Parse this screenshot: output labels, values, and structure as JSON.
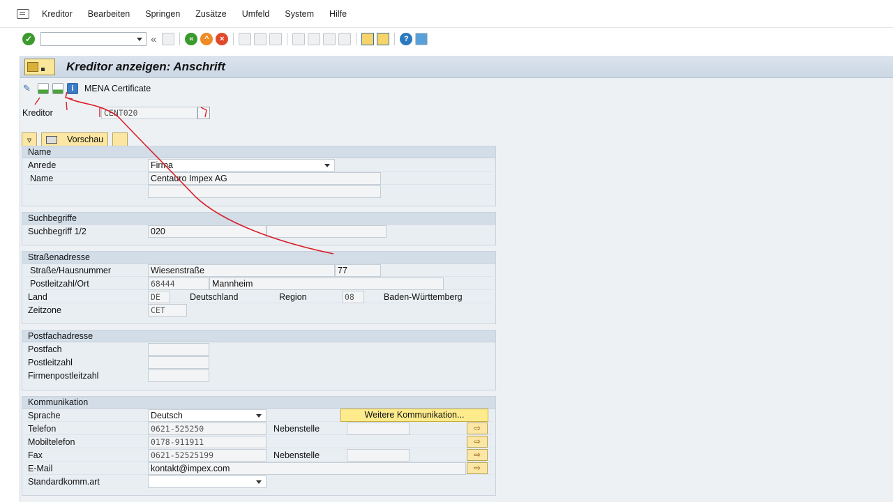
{
  "menu": {
    "items": [
      "Kreditor",
      "Bearbeiten",
      "Springen",
      "Zusätze",
      "Umfeld",
      "System",
      "Hilfe"
    ]
  },
  "toolbar": {
    "command_field": "",
    "back_glyph": "«"
  },
  "title": "Kreditor anzeigen: Anschrift",
  "app_toolbar": {
    "info_glyph": "i",
    "label": "MENA Certificate"
  },
  "kreditor": {
    "label": "Kreditor",
    "value": "CENT020"
  },
  "subbar": {
    "preview_label": "Vorschau"
  },
  "name_group": {
    "title": "Name",
    "anrede_label": "Anrede",
    "anrede_value": "Firma",
    "name_label": "Name",
    "name_value": "Centauro Impex AG",
    "name2_value": ""
  },
  "search_group": {
    "title": "Suchbegriffe",
    "label": "Suchbegriff 1/2",
    "value1": "020",
    "value2": ""
  },
  "street_group": {
    "title": "Straßenadresse",
    "street_label": "Straße/Hausnummer",
    "street_value": "Wiesenstraße",
    "house_no": "77",
    "plz_label": "Postleitzahl/Ort",
    "plz_value": "68444",
    "city_value": "Mannheim",
    "country_label": "Land",
    "country_code": "DE",
    "country_name": "Deutschland",
    "region_label": "Region",
    "region_code": "08",
    "region_name": "Baden-Württemberg",
    "timezone_label": "Zeitzone",
    "timezone_value": "CET"
  },
  "pobox_group": {
    "title": "Postfachadresse",
    "postfach_label": "Postfach",
    "postleitzahl_label": "Postleitzahl",
    "firmen_label": "Firmenpostleitzahl"
  },
  "comm_group": {
    "title": "Kommunikation",
    "sprache_label": "Sprache",
    "sprache_value": "Deutsch",
    "more_button": "Weitere Kommunikation...",
    "telefon_label": "Telefon",
    "telefon_value": "0621-525250",
    "nebenstelle_label": "Nebenstelle",
    "mobil_label": "Mobiltelefon",
    "mobil_value": "0178-911911",
    "fax_label": "Fax",
    "fax_value": "0621-52525199",
    "fax_nebenstelle_label": "Nebenstelle",
    "email_label": "E-Mail",
    "email_value": "kontakt@impex.com",
    "standard_label": "Standardkomm.art",
    "standard_value": ""
  },
  "colors": {
    "annotation": "#d8202a",
    "title_bar": "#cbd7e4",
    "group_header": "#d2dde8",
    "button_yellow": "#fdeb8c"
  }
}
